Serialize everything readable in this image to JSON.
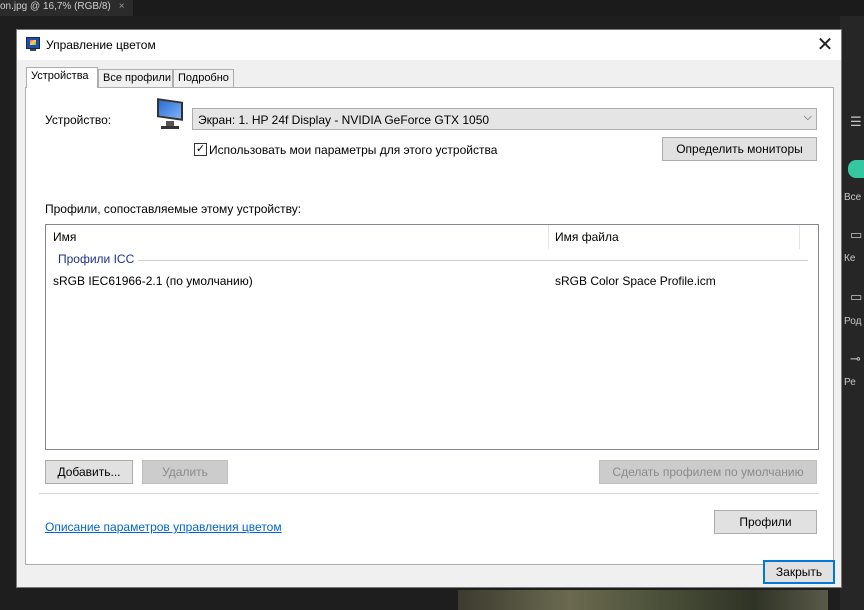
{
  "background_app": {
    "doc_tab_title": "on.jpg @ 16,7% (RGB/8)",
    "doc_tab_close": "×",
    "side_labels": [
      "Все ч",
      "Ке",
      "Род",
      "Ре"
    ]
  },
  "dialog": {
    "title": "Управление цветом",
    "close_glyph": "✕",
    "tabs": [
      {
        "label": "Устройства",
        "active": true
      },
      {
        "label": "Все профили",
        "active": false
      },
      {
        "label": "Подробно",
        "active": false
      }
    ]
  },
  "device": {
    "label": "Устройство:",
    "selected": "Экран: 1. HP 24f Display - NVIDIA GeForce GTX 1050",
    "dropdown_arrow": "⌵",
    "use_my_settings_label": "Использовать мои параметры для этого устройства",
    "use_my_settings_checked": true,
    "checkmark": "✓",
    "identify_button": "Определить мониторы"
  },
  "profiles": {
    "section_label": "Профили, сопоставляемые этому устройству:",
    "columns": [
      "Имя",
      "Имя файла"
    ],
    "group": "Профили ICC",
    "rows": [
      {
        "name": "sRGB IEC61966-2.1 (по умолчанию)",
        "file": "sRGB Color Space Profile.icm"
      }
    ]
  },
  "actions": {
    "add": "Добавить...",
    "remove": "Удалить",
    "set_default": "Сделать профилем по умолчанию",
    "remove_enabled": false,
    "set_default_enabled": false
  },
  "footer": {
    "help_link": "Описание параметров управления цветом",
    "profiles_button": "Профили",
    "close_button": "Закрыть"
  },
  "colors": {
    "accent": "#0078d7",
    "link": "#0066cc",
    "group_header": "#1e3287"
  }
}
